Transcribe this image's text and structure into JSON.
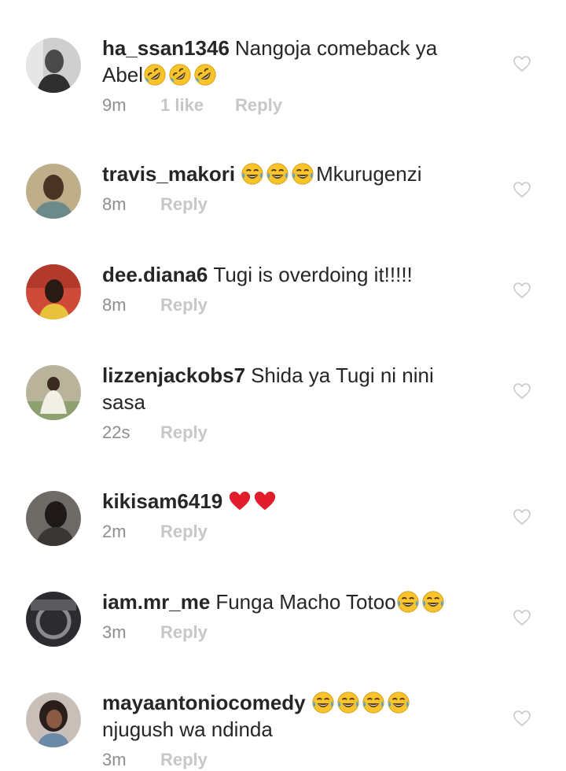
{
  "comments": [
    {
      "username": "ha_ssan1346",
      "text": "Nangoja comeback ya Abel",
      "emojis": [
        "rolling-laughing",
        "rolling-laughing",
        "rolling-laughing"
      ],
      "time": "9m",
      "likes": "1 like",
      "reply": "Reply",
      "avatar_colors": [
        "#c9c9c9",
        "#3a3a3a"
      ]
    },
    {
      "username": "travis_makori",
      "text_before": "",
      "emojis": [
        "tears-of-joy",
        "tears-of-joy",
        "tears-of-joy"
      ],
      "text": "Mkurugenzi",
      "time": "8m",
      "reply": "Reply",
      "avatar_colors": [
        "#bfae8a",
        "#4a3324"
      ]
    },
    {
      "username": "dee.diana6",
      "text": "Tugi is overdoing it!!!!!",
      "time": "8m",
      "reply": "Reply",
      "avatar_colors": [
        "#d04a3a",
        "#2a1a14"
      ]
    },
    {
      "username": "lizzenjackobs7",
      "text": "Shida ya Tugi ni nini sasa",
      "time": "22s",
      "reply": "Reply",
      "avatar_colors": [
        "#a8b38a",
        "#f2efe6"
      ]
    },
    {
      "username": "kikisam6419",
      "emojis": [
        "red-heart",
        "red-heart"
      ],
      "time": "2m",
      "reply": "Reply",
      "avatar_colors": [
        "#6e6a66",
        "#1f1a18"
      ]
    },
    {
      "username": "iam.mr_me",
      "text": "Funga Macho Totoo",
      "emojis": [
        "tears-of-joy",
        "tears-of-joy"
      ],
      "time": "3m",
      "reply": "Reply",
      "avatar_colors": [
        "#5a5a5e",
        "#1c1c1f"
      ]
    },
    {
      "username": "mayaantoniocomedy",
      "emojis": [
        "tears-of-joy",
        "tears-of-joy",
        "tears-of-joy",
        "tears-of-joy"
      ],
      "text": "njugush wa ndinda",
      "time": "3m",
      "reply": "Reply",
      "avatar_colors": [
        "#c8c0b8",
        "#2a1e1a"
      ]
    }
  ],
  "icons": {
    "like": "heart-outline-icon"
  },
  "colors": {
    "text": "#262626",
    "muted": "#8e8e8e",
    "faint": "#c7c7c7",
    "heart": "#e11d2b",
    "emoji": "#f7c52b"
  }
}
